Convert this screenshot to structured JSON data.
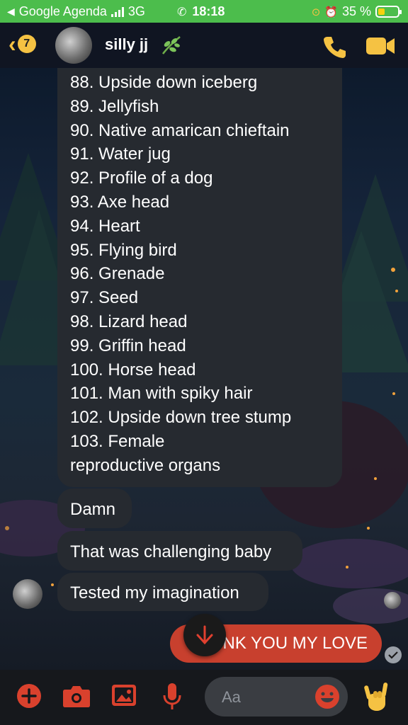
{
  "status_bar": {
    "carrier": "Google Agenda",
    "network": "3G",
    "time": "18:18",
    "battery": "35 %",
    "battery_level": 0.35
  },
  "header": {
    "back_badge": "7",
    "contact_name": "silly jj"
  },
  "messages": {
    "list": [
      "88. Upside down iceberg",
      "89. Jellyfish",
      "90. Native amarican chieftain",
      "91. Water jug",
      "92. Profile of a dog",
      "93. Axe head",
      "94. Heart",
      "95. Flying bird",
      "96. Grenade",
      "97. Seed",
      "98. Lizard head",
      "99. Griffin head",
      "100. Horse head",
      "101. Man with spiky hair",
      "102. Upside down tree stump",
      "103. Female",
      "reproductive organs"
    ],
    "m1": "Damn",
    "m2": "That was challenging baby",
    "m3": "Tested my imagination",
    "outgoing": "NK YOU MY LOVE"
  },
  "composer": {
    "placeholder": "Aa"
  },
  "colors": {
    "status_green": "#4cbd4c",
    "accent_yellow": "#f5c243",
    "outgoing_red": "#c8402e",
    "composer_red": "#d9412d"
  }
}
